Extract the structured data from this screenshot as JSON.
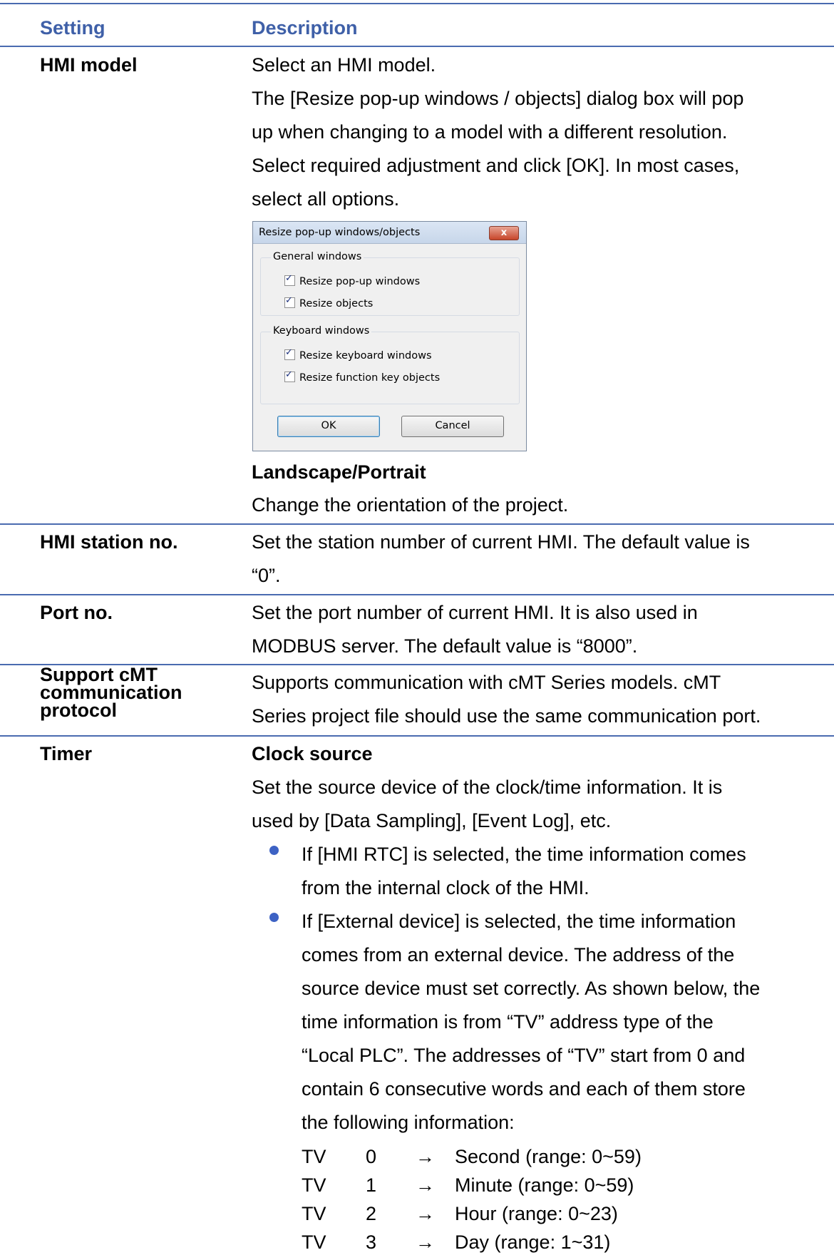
{
  "header": {
    "setting": "Setting",
    "description": "Description"
  },
  "hmi_model": {
    "setting": "HMI model",
    "lines": [
      "Select an HMI model.",
      "The [Resize pop-up windows / objects] dialog box will pop",
      "up when changing to a model with a different resolution.",
      "Select required adjustment and click [OK]. In most cases,",
      "select all options."
    ],
    "orientation_title": "Landscape/Portrait",
    "orientation_desc": "Change the orientation of the project."
  },
  "dialog": {
    "title": "Resize pop-up windows/objects",
    "close": "x",
    "general_group": "General windows",
    "general_options": [
      "Resize pop-up windows",
      "Resize objects"
    ],
    "keyboard_group": "Keyboard windows",
    "keyboard_options": [
      "Resize keyboard windows",
      "Resize function key objects"
    ],
    "ok": "OK",
    "cancel": "Cancel"
  },
  "station": {
    "setting": "HMI station no.",
    "lines": [
      "Set the station number of current HMI. The default value is",
      "“0”."
    ]
  },
  "port": {
    "setting": "Port no.",
    "lines": [
      "Set the port number of current HMI. It is also used in",
      "MODBUS server. The default value is “8000”."
    ]
  },
  "cmt": {
    "setting_lines": [
      "Support cMT",
      "communication",
      "protocol"
    ],
    "lines": [
      "Supports communication with cMT Series models. cMT",
      "Series project file should use the same communication port."
    ]
  },
  "timer": {
    "setting": "Timer",
    "clock_title": "Clock source",
    "lines": [
      "Set the source device of the clock/time information. It is",
      "used by [Data Sampling], [Event Log], etc."
    ],
    "bullet1": [
      "If [HMI RTC] is selected, the time information comes",
      "from the internal clock of the HMI."
    ],
    "bullet2": [
      "If [External device] is selected, the time information",
      "comes from an external device. The address of the",
      "source device must set correctly. As shown below, the",
      "time information is from “TV” address type of the",
      "“Local PLC”. The addresses of “TV” start from 0 and",
      "contain 6 consecutive words and each of them store",
      "the following information:"
    ],
    "tv_rows": [
      {
        "type": "TV",
        "addr": "0",
        "arrow": "→",
        "desc": "Second (range: 0~59)"
      },
      {
        "type": "TV",
        "addr": "1",
        "arrow": "→",
        "desc": "Minute (range: 0~59)"
      },
      {
        "type": "TV",
        "addr": "2",
        "arrow": "→",
        "desc": "Hour (range: 0~23)"
      },
      {
        "type": "TV",
        "addr": "3",
        "arrow": "→",
        "desc": "Day (range: 1~31)"
      }
    ]
  }
}
